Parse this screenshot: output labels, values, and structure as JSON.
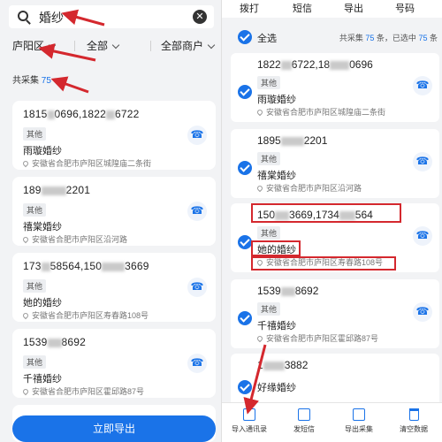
{
  "left": {
    "search": {
      "query": "婚纱",
      "icon": "search-icon",
      "clear_icon": "clear-icon"
    },
    "filters": [
      {
        "label": "庐阳区"
      },
      {
        "label": "全部"
      },
      {
        "label": "全部商户"
      }
    ],
    "count": {
      "label": "共采集",
      "value": "75"
    },
    "cards": [
      {
        "phone_a": "1815",
        "phone_b": "0696,1822",
        "phone_c": "6722",
        "tag": "其他",
        "name": "雨璇婚纱",
        "address": "安徽省合肥市庐阳区城隍庙二条街"
      },
      {
        "phone_a": "189",
        "phone_b": "",
        "phone_c": "2201",
        "tag": "其他",
        "name": "禧棠婚纱",
        "address": "安徽省合肥市庐阳区沿河路"
      },
      {
        "phone_a": "173",
        "phone_b": "58564,150",
        "phone_c": "3669",
        "tag": "其他",
        "name": "她的婚纱",
        "address": "安徽省合肥市庐阳区寿春路108号"
      },
      {
        "phone_a": "1539",
        "phone_b": "",
        "phone_c": "8692",
        "tag": "其他",
        "name": "千禧婚纱",
        "address": "安徽省合肥市庐阳区霍邱路87号"
      }
    ],
    "export_button": "立即导出"
  },
  "right": {
    "top_tabs": [
      "拨打",
      "短信",
      "导出",
      "号码"
    ],
    "select_all": "全选",
    "summary": {
      "prefix": "共采集",
      "total": "75",
      "mid": "条，已选中",
      "selected": "75",
      "suffix": "条"
    },
    "cards": [
      {
        "phone_a": "1822",
        "phone_b": "6722,18",
        "phone_c": "0696",
        "tag": "其他",
        "name": "雨璇婚纱",
        "address": "安徽省合肥市庐阳区城隍庙二条街"
      },
      {
        "phone_a": "1895",
        "phone_b": "",
        "phone_c": "2201",
        "tag": "其他",
        "name": "禧棠婚纱",
        "address": "安徽省合肥市庐阳区沿河路"
      },
      {
        "phone_a": "150",
        "phone_b": "3669,1734",
        "phone_c": "564",
        "tag": "其他",
        "name": "她的婚纱",
        "address": "安徽省合肥市庐阳区寿春路108号"
      },
      {
        "phone_a": "1539",
        "phone_b": "",
        "phone_c": "8692",
        "tag": "其他",
        "name": "千禧婚纱",
        "address": "安徽省合肥市庐阳区霍邱路87号"
      },
      {
        "phone_a": "1",
        "phone_b": "",
        "phone_c": "3882",
        "tag": "",
        "name": "好缘婚纱",
        "address": ""
      }
    ],
    "bottom_bar": [
      {
        "label": "导入通讯录",
        "icon": "contacts-icon"
      },
      {
        "label": "发短信",
        "icon": "sms-icon"
      },
      {
        "label": "导出采集",
        "icon": "export-icon"
      },
      {
        "label": "清空数据",
        "icon": "trash-icon"
      }
    ]
  },
  "colors": {
    "accent": "#1a73e8",
    "annotation": "#d4282e"
  }
}
